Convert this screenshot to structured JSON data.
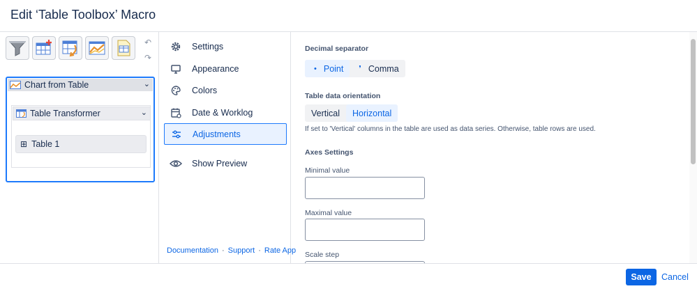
{
  "dialog": {
    "title": "Edit ‘Table Toolbox’ Macro"
  },
  "toolbar": {
    "tools": [
      "filter-icon",
      "table-add-icon",
      "table-transform-icon",
      "chart-icon",
      "document-icon"
    ],
    "undo_icon": "undo-icon",
    "redo_icon": "redo-icon"
  },
  "tree": {
    "chart_node": "Chart from Table",
    "transformer_node": "Table Transformer",
    "table_node": "Table 1"
  },
  "nav": {
    "items": [
      {
        "label": "Settings",
        "icon": "gear-icon"
      },
      {
        "label": "Appearance",
        "icon": "monitor-icon"
      },
      {
        "label": "Colors",
        "icon": "palette-icon"
      },
      {
        "label": "Date & Worklog",
        "icon": "calendar-icon"
      },
      {
        "label": "Adjustments",
        "icon": "sliders-icon",
        "active": true
      },
      {
        "label": "Show Preview",
        "icon": "eye-icon"
      }
    ],
    "links": [
      "Documentation",
      "Support",
      "Rate App"
    ]
  },
  "content": {
    "decimal_separator": {
      "label": "Decimal separator",
      "options": [
        {
          "symbol": "•",
          "label": "Point",
          "selected": true
        },
        {
          "symbol": "❜",
          "label": "Comma",
          "selected": false
        }
      ]
    },
    "orientation": {
      "label": "Table data orientation",
      "options": [
        {
          "label": "Vertical",
          "selected": false
        },
        {
          "label": "Horizontal",
          "selected": true
        }
      ],
      "hint": "If set to 'Vertical' columns in the table are used as data series. Otherwise, table rows are used."
    },
    "axes": {
      "label": "Axes Settings",
      "minimal_value_label": "Minimal value",
      "minimal_value": "",
      "maximal_value_label": "Maximal value",
      "maximal_value": "",
      "scale_step_label": "Scale step",
      "scale_step": ""
    }
  },
  "footer": {
    "save_label": "Save",
    "cancel_label": "Cancel"
  },
  "colors": {
    "accent": "#0c66e4",
    "active_border": "#1d7afc",
    "active_bg": "#e9f2ff"
  }
}
